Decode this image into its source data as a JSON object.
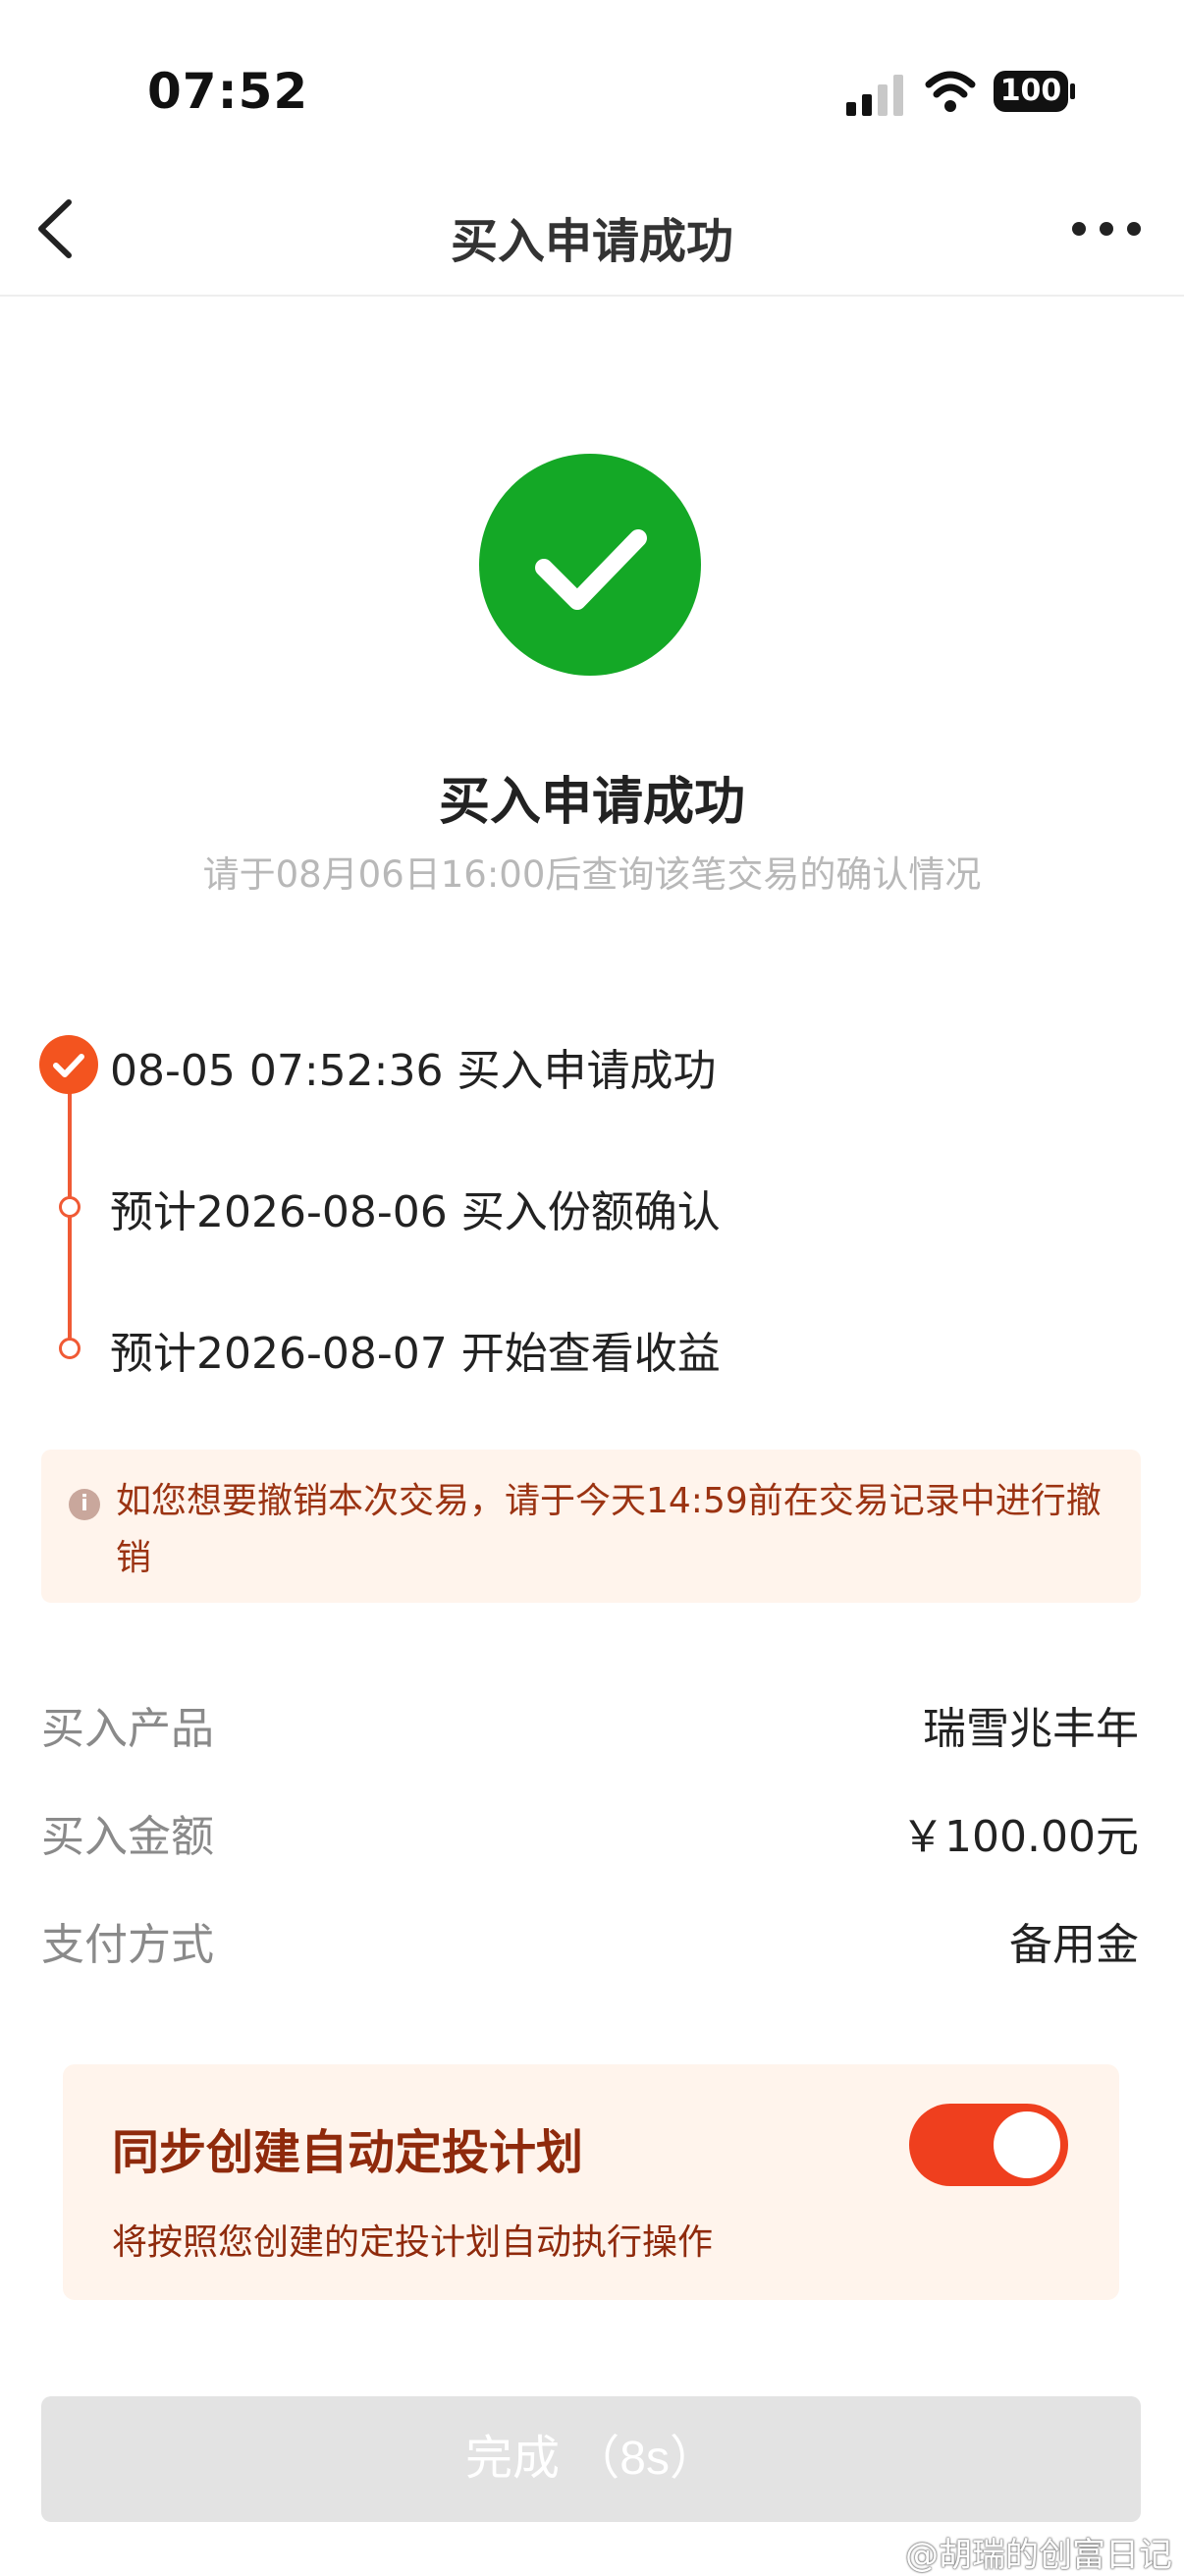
{
  "status_bar": {
    "time": "07:52",
    "battery": "100"
  },
  "nav": {
    "title": "买入申请成功"
  },
  "result": {
    "title": "买入申请成功",
    "subtitle": "请于08月06日16:00后查询该笔交易的确认情况"
  },
  "timeline": [
    {
      "text": "08-05 07:52:36 买入申请成功",
      "status": "done"
    },
    {
      "text": "预计2026-08-06 买入份额确认",
      "status": "pending"
    },
    {
      "text": "预计2026-08-07 开始查看收益",
      "status": "pending"
    }
  ],
  "notice": {
    "icon": "info-icon",
    "text": "如您想要撤销本次交易，请于今天14:59前在交易记录中进行撤销"
  },
  "details": [
    {
      "label": "买入产品",
      "value": "瑞雪兆丰年"
    },
    {
      "label": "买入金额",
      "value": "￥100.00元"
    },
    {
      "label": "支付方式",
      "value": "备用金"
    }
  ],
  "plan": {
    "title": "同步创建自动定投计划",
    "description": "将按照您创建的定投计划自动执行操作",
    "toggle_on": true
  },
  "done_button": {
    "label": "完成 （8s）"
  },
  "watermark": "@胡瑞的创富日记",
  "colors": {
    "success": "#14a826",
    "accent": "#f3541f",
    "notice_bg": "#fff4ec",
    "notice_text": "#9b3312",
    "toggle": "#ef3f1e"
  }
}
